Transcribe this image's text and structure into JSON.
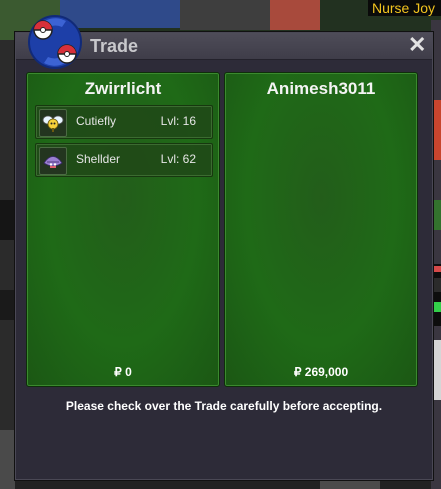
{
  "window": {
    "title": "Trade",
    "close_icon": "close-icon",
    "logo_icon": "trade-pokeball-icon",
    "notice": "Please check over the Trade carefully before accepting."
  },
  "background": {
    "npc_label": "Nurse Joy"
  },
  "left_trader": {
    "name": "Zwirrlicht",
    "money": "₽ 0",
    "pokemon": [
      {
        "name": "Cutiefly",
        "level": "Lvl: 16",
        "icon": "cutiefly-sprite-icon"
      },
      {
        "name": "Shellder",
        "level": "Lvl: 62",
        "icon": "shellder-sprite-icon"
      }
    ]
  },
  "right_trader": {
    "name": "Animesh3011",
    "money": "₽ 269,000",
    "pokemon": []
  },
  "colors": {
    "panel_green": "#1f6a17",
    "window_bg": "#2d2b38",
    "title_text": "#c8c8cc",
    "npc_label_text": "#f3c41f"
  }
}
